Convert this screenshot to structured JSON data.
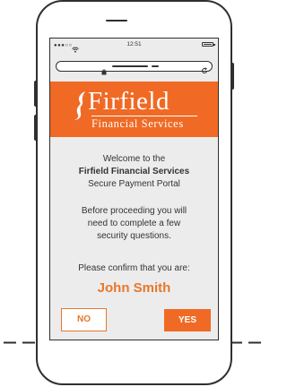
{
  "status_bar": {
    "signal": "●●●○○",
    "time": "12:51",
    "battery_level": 0.9,
    "icons": [
      "wifi-icon",
      "battery-icon"
    ]
  },
  "browser": {
    "icons": [
      "lock-icon",
      "reload-icon"
    ]
  },
  "brand": {
    "name": "Firfield",
    "subtitle": "Financial Services",
    "color": "#f06a25"
  },
  "content": {
    "welcome_line1": "Welcome to the",
    "welcome_line2": "Firfield Financial Services",
    "welcome_line3": "Secure Payment Portal",
    "instructions_line1": "Before proceeding you will",
    "instructions_line2": "need to complete a few",
    "instructions_line3": "security questions.",
    "confirm_prompt": "Please confirm that you are:",
    "user_name": "John Smith"
  },
  "actions": {
    "no_label": "NO",
    "yes_label": "YES"
  }
}
